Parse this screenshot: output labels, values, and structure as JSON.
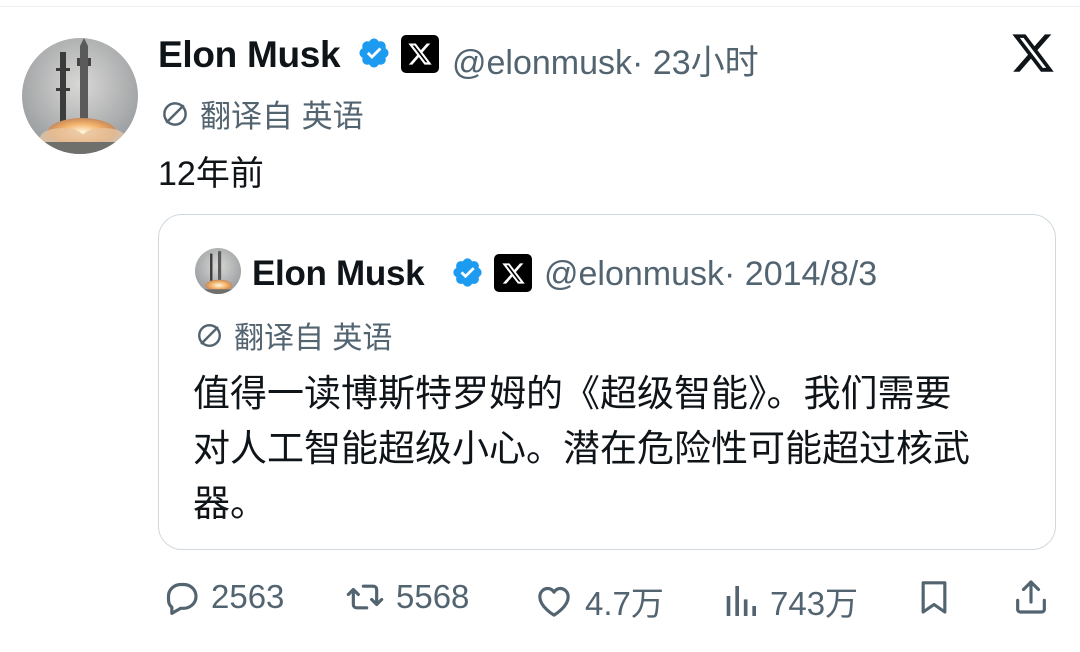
{
  "tweet": {
    "author_name": "Elon Musk",
    "handle": "@elonmusk",
    "time": "· 23小时",
    "translated_label": "翻译自 英语",
    "text": "12年前"
  },
  "quote": {
    "author_name": "Elon Musk",
    "handle": "@elonmusk",
    "date": "· 2014/8/3",
    "translated_label": "翻译自 英语",
    "text_lines": [
      "值得一读博斯特罗姆的《超级智能》。我们需要",
      "对人工智能超级小心。潜在危险性可能超过核武",
      "器。"
    ]
  },
  "actions": {
    "replies": "2563",
    "reposts": "5568",
    "likes": "4.7万",
    "views": "743万"
  },
  "icons": {
    "close": "close-x-icon",
    "verified": "verified-badge-icon",
    "x_logo": "x-logo-icon",
    "translate": "translate-icon",
    "reply": "reply-icon",
    "repost": "repost-icon",
    "like": "like-icon",
    "views": "views-icon",
    "bookmark": "bookmark-icon",
    "share": "share-icon"
  },
  "colors": {
    "verified_blue": "#1d9bf0",
    "secondary_text": "#536471",
    "primary_text": "#0f1419",
    "border": "#cfd9de"
  }
}
